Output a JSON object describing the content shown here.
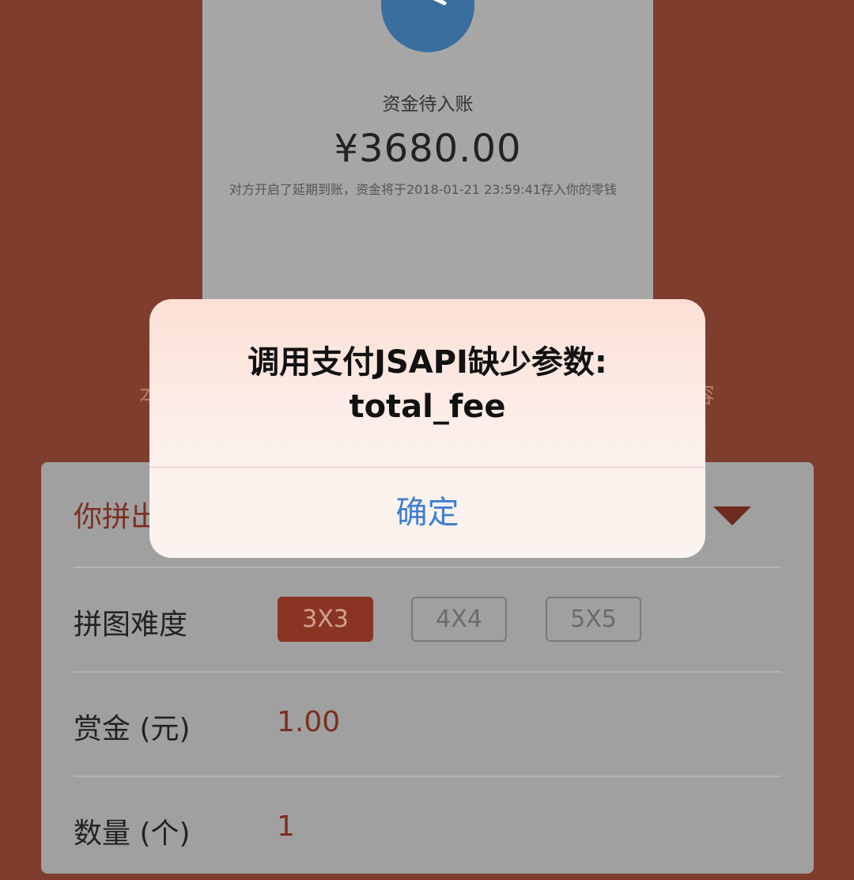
{
  "background_screen": {
    "status_title": "资金待入账",
    "amount": "¥3680.00",
    "note": "对方开启了延期到账，资金将于2018-01-21 23:59:41存入你的零钱",
    "left_partial_char": "本",
    "right_partial_char": "容"
  },
  "form": {
    "first_row_label": "你拼出",
    "difficulty": {
      "label": "拼图难度",
      "options": [
        "3X3",
        "4X4",
        "5X5"
      ],
      "selected": "3X3"
    },
    "reward": {
      "label": "赏金 (元)",
      "value": "1.00"
    },
    "quantity": {
      "label": "数量 (个)",
      "value": "1"
    }
  },
  "dialog": {
    "message_line1": "调用支付JSAPI缺少参数:",
    "message_line2": "total_fee",
    "confirm_label": "确定"
  },
  "colors": {
    "page_bg": "#7f3d2e",
    "accent": "#8a3524",
    "dialog_button": "#3f7fd0",
    "clock": "#3a6e9e"
  },
  "icons": [
    "clock-icon",
    "dropdown-caret-icon"
  ]
}
